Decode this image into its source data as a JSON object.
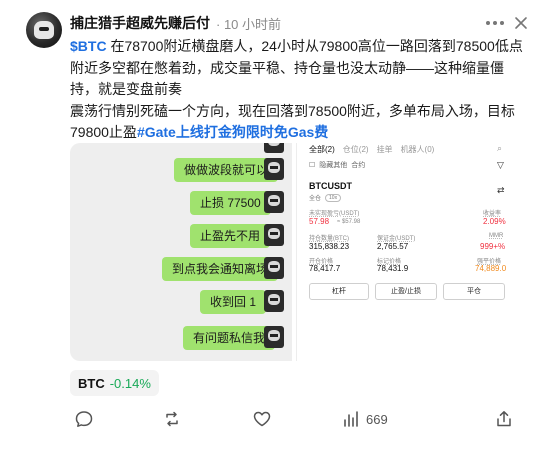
{
  "post": {
    "username": "捕庄猎手超威先赚后付",
    "time": "· 10 小时前",
    "cashtag": "$BTC",
    "line1_rest": " 在78700附近横盘磨人，24小时从79800高位一路回落到78500低点附近多空都在憋着劲，成交量平稳、持仓量也没太动静——这种缩量僵持，就是变盘前奏",
    "line2": "震荡行情别死磕一个方向，现在回落到78500附近，多单布局入场，目标79800止盈",
    "hashtag": "#Gate上线打金狗限时免Gas费"
  },
  "chat": {
    "bubbles": [
      "做做波段就可以",
      "止损 77500",
      "止盈先不用",
      "到点我会通知离场",
      "收到回 1",
      "有问题私信我"
    ]
  },
  "trade_screen": {
    "tabs": [
      "全部(2)",
      "仓位(2)",
      "挂单",
      "机器人(0)"
    ],
    "subtabs": [
      "隐藏其他",
      "合约"
    ],
    "pair": "BTCUSDT",
    "pair_sub": "全仓",
    "leverage": "10x",
    "labels": {
      "upnl": "未实现盈亏(USDT)",
      "roe": "收益率",
      "size": "持仓数量(BTC)",
      "margin": "保证金(USDT)",
      "mmr": "MMR",
      "entry": "开仓价格",
      "mark": "标记价格",
      "liq": "强平价格"
    },
    "values": {
      "upnl": "57.98",
      "upnl_sub": "≈ $57.98",
      "roe": "2.09%",
      "size": "315,838.23",
      "margin": "2,765.57",
      "mmr": "999+%",
      "entry": "78,417.7",
      "mark": "78,431.9",
      "liq": "74,889.0"
    },
    "buttons": [
      "杠杆",
      "止盈/止损",
      "平仓"
    ]
  },
  "ticker": {
    "symbol": "BTC",
    "change": "-0.14%"
  },
  "actions": {
    "views": "669"
  },
  "colors": {
    "link": "#1f6fe0",
    "bubble": "#a0e26e",
    "positive": "#18a957",
    "negative": "#f0303f"
  }
}
